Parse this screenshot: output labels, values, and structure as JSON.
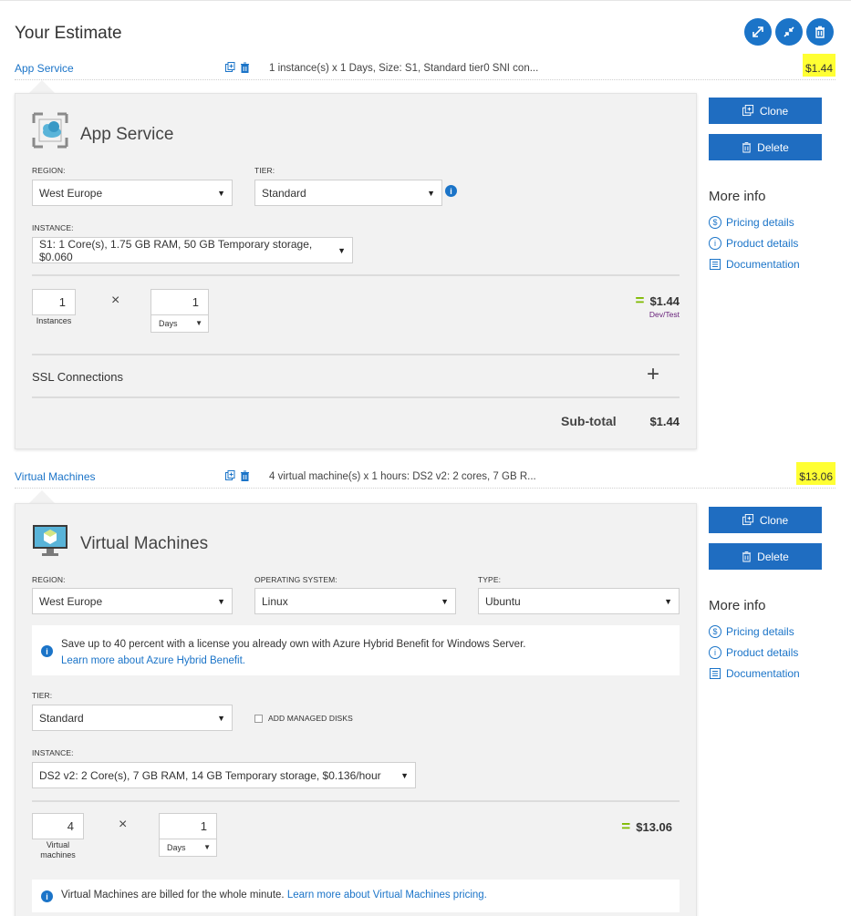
{
  "page": {
    "title": "Your Estimate"
  },
  "services": [
    {
      "name": "App Service",
      "description": "1 instance(s) x 1 Days, Size: S1, Standard tier0 SNI con...",
      "price": "$1.44",
      "panel": {
        "title": "App Service",
        "region_label": "REGION:",
        "region_value": "West Europe",
        "tier_label": "TIER:",
        "tier_value": "Standard",
        "instance_label": "INSTANCE:",
        "instance_value": "S1: 1 Core(s), 1.75 GB RAM, 50 GB Temporary storage, $0.060",
        "instances_count": "1",
        "instances_label": "Instances",
        "days_count": "1",
        "days_unit": "Days",
        "times_symbol": "×",
        "line_price": "$1.44",
        "line_note": "Dev/Test",
        "ssl_label": "SSL Connections",
        "subtotal_label": "Sub-total",
        "subtotal_value": "$1.44"
      }
    },
    {
      "name": "Virtual Machines",
      "description": "4 virtual machine(s) x 1 hours: DS2 v2: 2 cores, 7 GB R...",
      "price": "$13.06",
      "panel": {
        "title": "Virtual Machines",
        "region_label": "REGION:",
        "region_value": "West Europe",
        "os_label": "OPERATING SYSTEM:",
        "os_value": "Linux",
        "type_label": "TYPE:",
        "type_value": "Ubuntu",
        "hybrid_notice": "Save up to 40 percent with a license you already own with Azure Hybrid Benefit for Windows Server.",
        "hybrid_link": "Learn more about Azure Hybrid Benefit.",
        "tier_label": "TIER:",
        "tier_value": "Standard",
        "managed_disks_label": "ADD MANAGED DISKS",
        "instance_label": "INSTANCE:",
        "instance_value": "DS2 v2: 2 Core(s), 7 GB RAM, 14 GB Temporary storage, $0.136/hour",
        "vm_count": "4",
        "vm_label_line1": "Virtual",
        "vm_label_line2": "machines",
        "days_count": "1",
        "days_unit": "Days",
        "times_symbol": "×",
        "line_price": "$13.06",
        "billing_notice": "Virtual Machines are billed for the whole minute.",
        "billing_link": "Learn more about Virtual Machines pricing."
      }
    }
  ],
  "actions": {
    "clone_label": "Clone",
    "delete_label": "Delete",
    "more_info_title": "More info",
    "pricing_details": "Pricing details",
    "product_details": "Product details",
    "documentation": "Documentation"
  },
  "symbols": {
    "equals": "=",
    "plus": "+",
    "info": "i",
    "dollar": "$"
  },
  "colors": {
    "accent": "#1b74c8",
    "button": "#1f6dc1",
    "highlight": "#ffff33",
    "equals_green": "#7fba00",
    "devtest_purple": "#68217a"
  }
}
